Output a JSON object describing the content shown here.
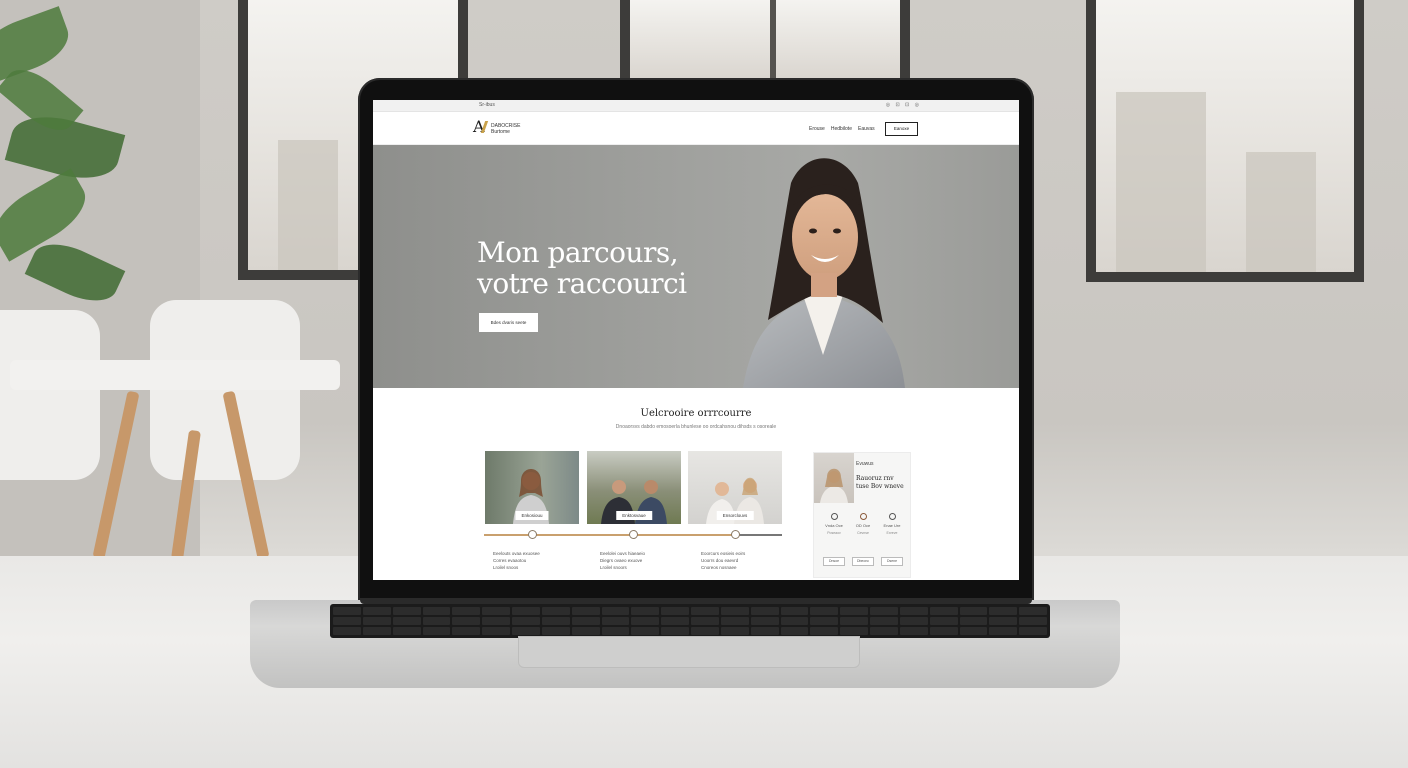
{
  "site": {
    "topbar": {
      "text": "Sr-ibus",
      "icons": "◎ ⊡ ⊡ ◎"
    },
    "logo": {
      "mark": "A",
      "line1": "DABOCRISE",
      "line2": "Burtome"
    },
    "nav": {
      "links": [
        "Erouse",
        "Hedbilote",
        "Eauvas"
      ],
      "cta": "Eanoxe"
    },
    "hero": {
      "title_line1": "Mon parcours,",
      "title_line2": "votre raccourci",
      "button": "Bdes dvaris seete"
    },
    "section": {
      "title": "Uelcrooire orrrcourre",
      "subtitle": "Dnoaorsvs dabdo emosoerla bhunlese oo ordcahsnou dihsds s osoreale"
    },
    "cards": [
      {
        "label": "Enkosiouu",
        "line1": "Eeelouts ovaa exuosee",
        "line2": "Corres evaaotou",
        "line3": "Lroilel snoos"
      },
      {
        "label": "Enktosvaue",
        "line1": "Eeelolei ouvs hiaeaeio",
        "line2": "Diegrs ovaeo exuove",
        "line3": "Lroilel snoors"
      },
      {
        "label": "Ensorclouvs",
        "line1": "Eoorcurs eosieis eoirs",
        "line2": "Uoorrs dou eaevrd",
        "line3": "Cnoreos nosnaee"
      }
    ],
    "side_panel": {
      "heading": "Evuwus",
      "title": "Rauoruz rnv tuse Bov wneve",
      "stats": [
        {
          "label": "Vnda Oce",
          "sub": "Poseaov"
        },
        {
          "label": "OD Oce",
          "sub": "Cevnse"
        },
        {
          "label": "Enae Ure",
          "sub": "Exreve"
        }
      ],
      "buttons": [
        "Dnsoe",
        "Dbeonc",
        "Dsene"
      ]
    }
  },
  "colors": {
    "accent_gold": "#c9a24b",
    "timeline": "#c9a06e",
    "hero_bg": "#9d9e9b"
  }
}
